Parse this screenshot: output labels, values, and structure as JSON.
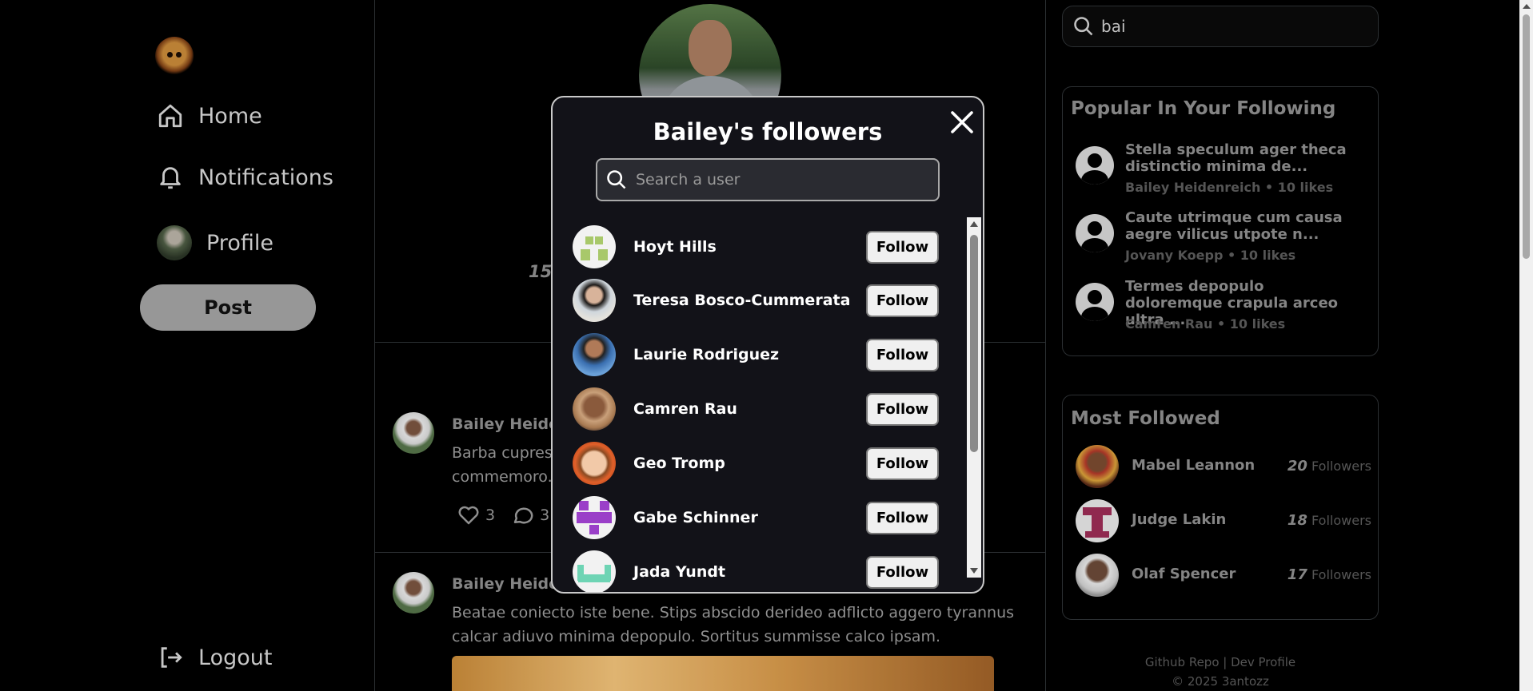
{
  "sidebar": {
    "nav": [
      {
        "label": "Home",
        "icon": "home-icon"
      },
      {
        "label": "Notifications",
        "icon": "bell-icon"
      },
      {
        "label": "Profile",
        "icon": "avatar"
      }
    ],
    "post_label": "Post",
    "logout_label": "Logout"
  },
  "main": {
    "stat_partial": "15",
    "posts": [
      {
        "author": "Bailey Heider",
        "body": "Barba cupress",
        "body2": "commemoro.",
        "likes": "3",
        "comments": "3"
      },
      {
        "author": "Bailey Heider",
        "body": "Beatae coniecto iste bene. Stips abscido derideo adflicto aggero tyrannus calcar adiuvo minima depopulo. Sortitus summisse calco ipsam."
      }
    ]
  },
  "right": {
    "search_value": "bai",
    "popular": {
      "title": "Popular In Your Following",
      "items": [
        {
          "title": "Stella speculum ager theca distinctio minima de...",
          "meta": "Bailey Heidenreich • 10 likes"
        },
        {
          "title": "Caute utrimque cum causa aegre vilicus utpote n...",
          "meta": "Jovany Koepp • 10 likes"
        },
        {
          "title": "Termes depopulo doloremque crapula arceo ultra ...",
          "meta": "Camren Rau • 10 likes"
        }
      ]
    },
    "most_followed": {
      "title": "Most Followed",
      "followers_label": "Followers",
      "items": [
        {
          "name": "Mabel Leannon",
          "count": "20"
        },
        {
          "name": "Judge Lakin",
          "count": "18"
        },
        {
          "name": "Olaf Spencer",
          "count": "17"
        }
      ]
    },
    "footer": {
      "links": "Github Repo | Dev Profile",
      "copyright": "© 2025 3antozz"
    }
  },
  "modal": {
    "title": "Bailey's followers",
    "search_placeholder": "Search a user",
    "follow_label": "Follow",
    "followers": [
      {
        "name": "Hoyt Hills"
      },
      {
        "name": "Teresa Bosco-Cummerata"
      },
      {
        "name": "Laurie Rodriguez"
      },
      {
        "name": "Camren Rau"
      },
      {
        "name": "Geo Tromp"
      },
      {
        "name": "Gabe Schinner"
      },
      {
        "name": "Jada Yundt"
      }
    ]
  },
  "colors": {
    "background": "#000000",
    "modal_bg": "#121218",
    "button_bg": "#f0f0f0",
    "post_button": "#a3a3a3"
  }
}
